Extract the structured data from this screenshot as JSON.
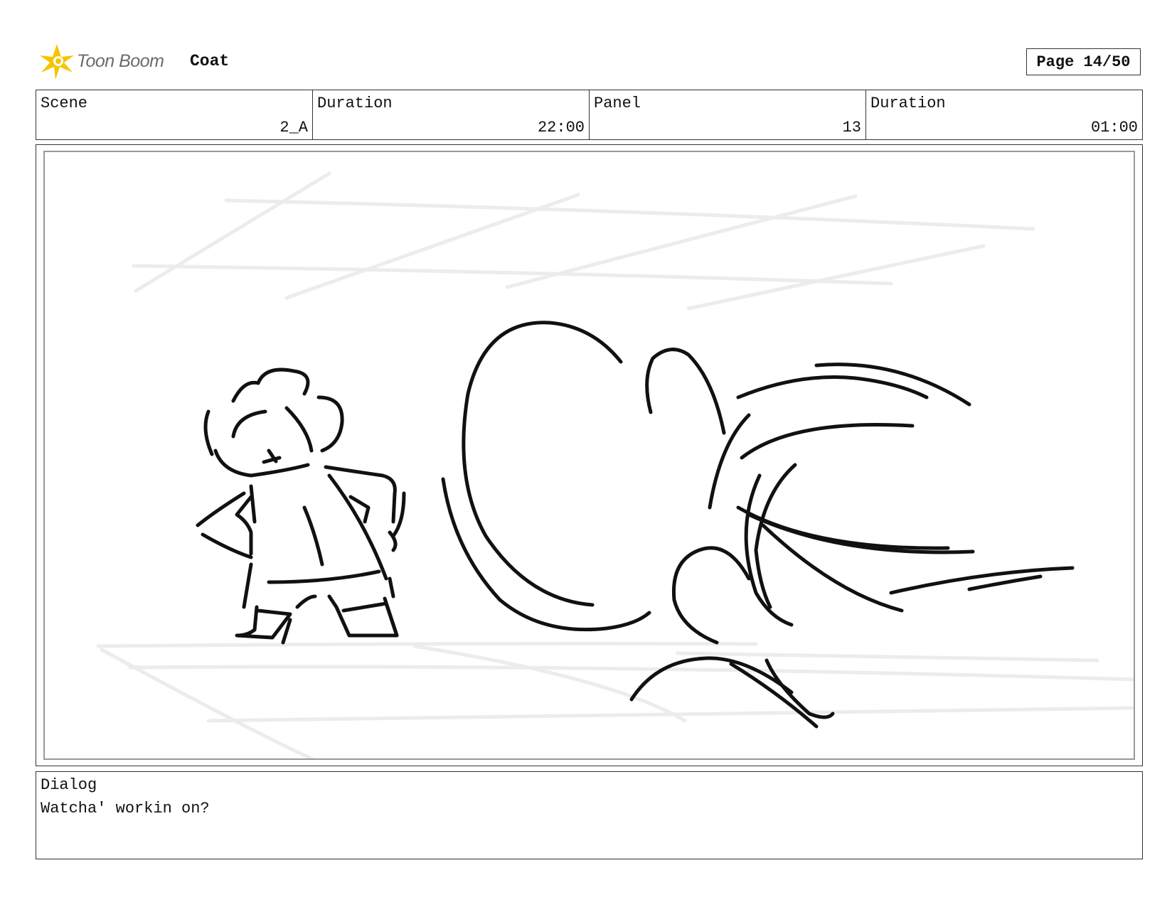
{
  "header": {
    "logo_text": "Toon Boom",
    "project_title": "Coat",
    "page_label": "Page 14/50"
  },
  "info": {
    "scene_label": "Scene",
    "scene_value": "2_A",
    "scene_duration_label": "Duration",
    "scene_duration_value": "22:00",
    "panel_label": "Panel",
    "panel_value": "13",
    "panel_duration_label": "Duration",
    "panel_duration_value": "01:00"
  },
  "dialog": {
    "label": "Dialog",
    "text": "Watcha' workin on?"
  },
  "colors": {
    "logo_accent": "#f5c400",
    "sketch_line": "#111111",
    "guide_line": "#ebebeb"
  }
}
